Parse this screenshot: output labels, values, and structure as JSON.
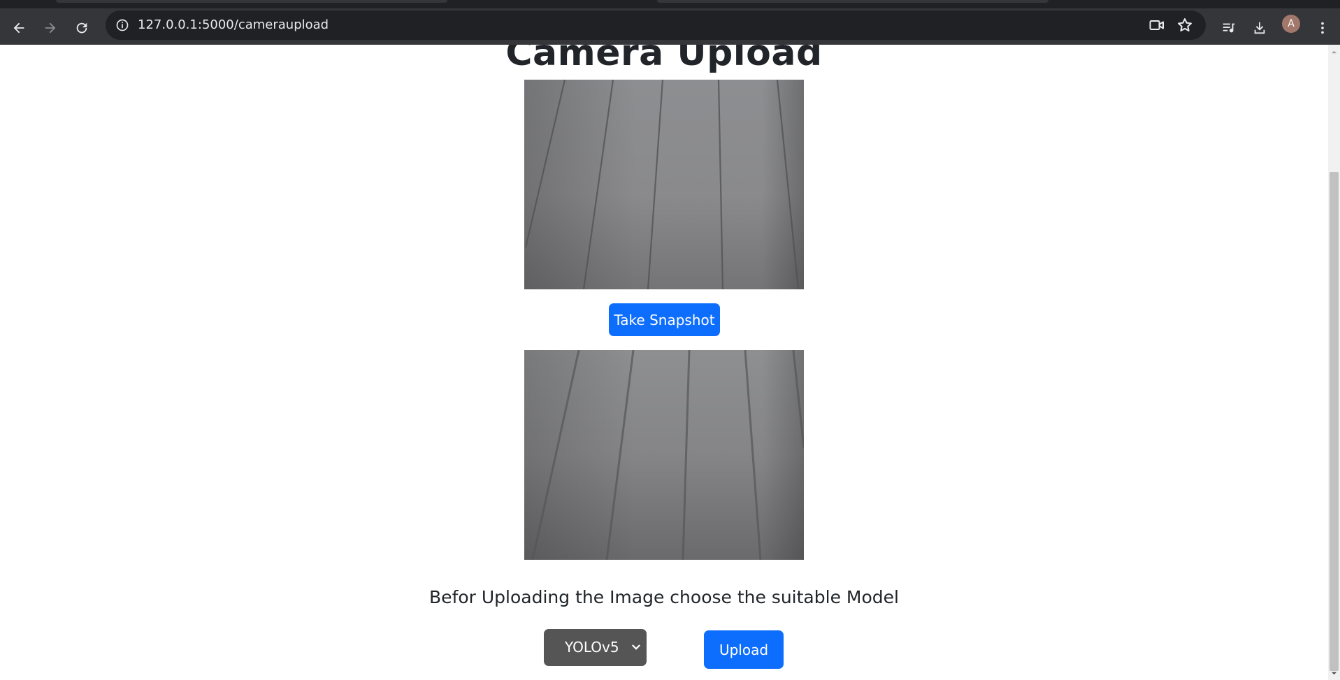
{
  "browser": {
    "url": "127.0.0.1:5000/cameraupload",
    "avatar_initial": "A",
    "icons": {
      "back": "back-arrow-icon",
      "forward": "forward-arrow-icon",
      "reload": "reload-icon",
      "site_info": "site-info-icon",
      "camera_in_use": "video-camera-icon",
      "bookmark": "star-icon",
      "media": "media-controls-icon",
      "downloads": "download-icon",
      "menu": "kebab-menu-icon"
    }
  },
  "page": {
    "title": "Camera Upload",
    "snapshot_button": "Take Snapshot",
    "instructions": "Befor Uploading the Image choose the suitable Model",
    "model_select": {
      "selected": "YOLOv5"
    },
    "upload_button": "Upload"
  },
  "colors": {
    "primary": "#0d6efd",
    "select_bg": "#555555",
    "text": "#212529",
    "chrome": "#35363a"
  }
}
